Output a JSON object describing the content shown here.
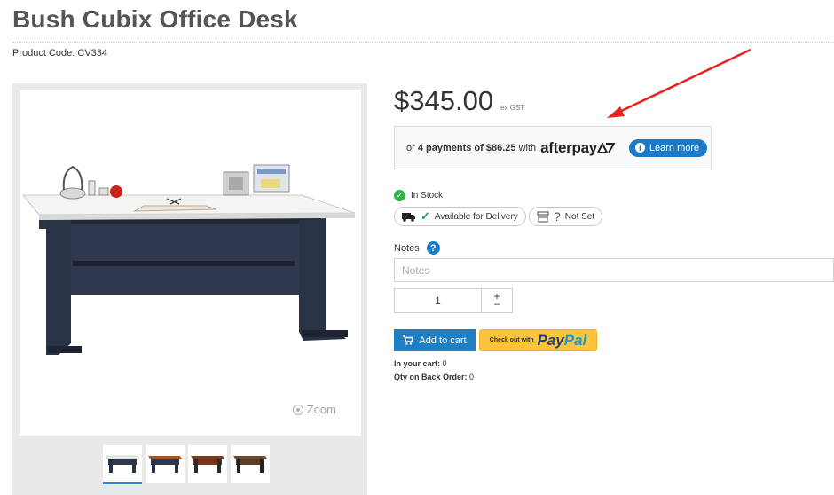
{
  "product": {
    "title": "Bush Cubix Office Desk",
    "code_label": "Product Code:",
    "code": "CV334"
  },
  "gallery": {
    "zoom_label": "Zoom",
    "thumbnail_count": 4,
    "active_thumbnail": 1,
    "thumbnail_finishes": [
      "slate",
      "cherry-slate",
      "cherry",
      "walnut"
    ]
  },
  "pricing": {
    "price": "$345.00",
    "suffix": "ex GST"
  },
  "afterpay": {
    "prefix": "or",
    "payments": "4 payments of $86.25",
    "with": "with",
    "brand": "afterpay",
    "learn_more": "Learn more",
    "brand_color": "#1c7bc8"
  },
  "availability": {
    "stock_status": "In Stock",
    "delivery": "Available for Delivery",
    "pickup_placeholder": "?",
    "pickup_status": "Not Set"
  },
  "notes": {
    "label": "Notes",
    "help": "?",
    "placeholder": "Notes",
    "value": ""
  },
  "quantity": {
    "value": "1",
    "increment": "+",
    "decrement": "−"
  },
  "actions": {
    "add_to_cart": "Add to cart",
    "paypal_prefix": "Check out with",
    "paypal_pay": "Pay",
    "paypal_pal": "Pal"
  },
  "cart": {
    "in_cart_label": "In your cart:",
    "in_cart_value": "0",
    "backorder_label": "Qty on Back Order:",
    "backorder_value": "0"
  },
  "colors": {
    "accent": "#1c7bc8",
    "in_stock": "#2fb34b",
    "paypal_button": "#fcc439",
    "annotation_arrow": "#e8231f"
  }
}
